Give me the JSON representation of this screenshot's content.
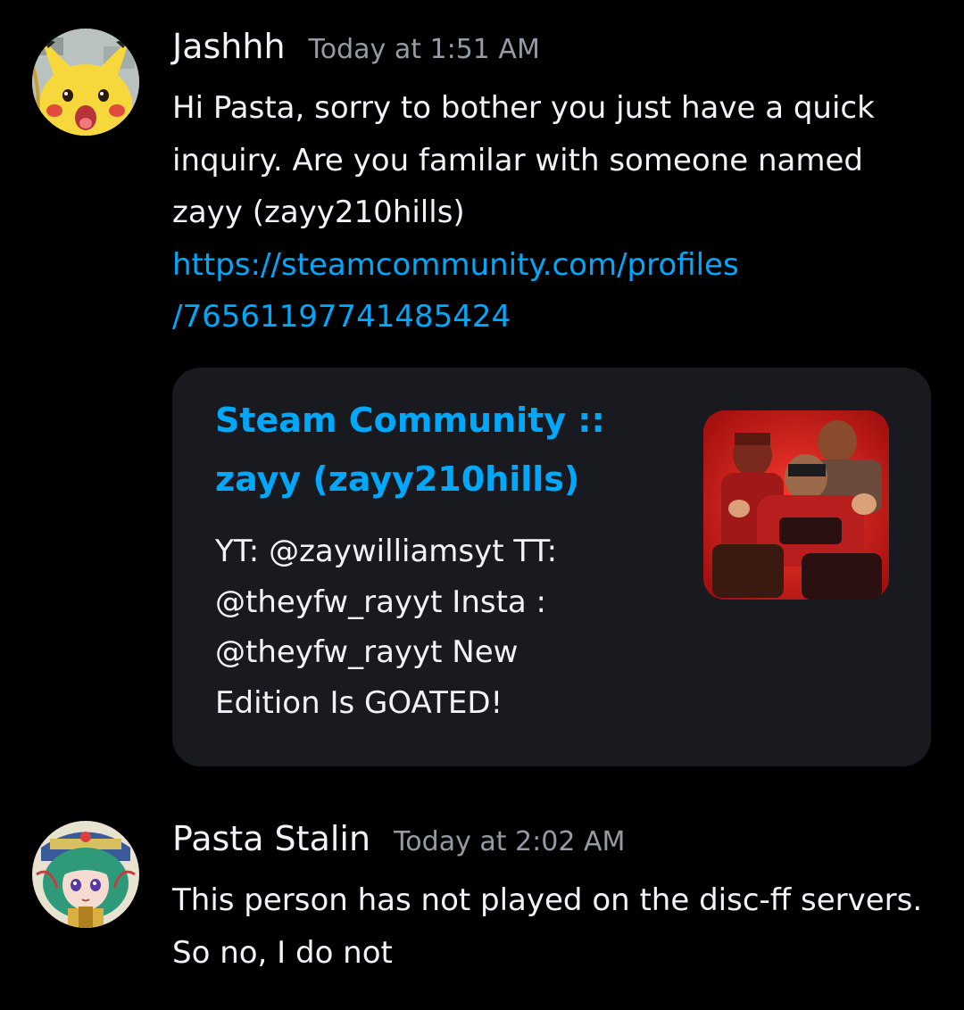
{
  "messages": [
    {
      "username": "Jashhh",
      "timestamp": "Today at 1:51 AM",
      "text": "Hi Pasta, sorry to bother you just have a quick inquiry. Are you familar with someone named zayy (zayy210hills)",
      "link_line1": "https://steamcommunity.com/profiles",
      "link_line2": "/76561197741485424",
      "avatar_icon": "pikachu-avatar-icon",
      "embed": {
        "title": "Steam Community :: zayy (zayy210hills)",
        "description": "YT: @zaywilliamsyt TT: @theyfw_rayyt Insta : @theyfw_rayyt New Edition Is GOATED!",
        "thumbnail_icon": "red-team-soldiers-thumbnail"
      }
    },
    {
      "username": "Pasta Stalin",
      "timestamp": "Today at 2:02 AM",
      "text": "This person has not played on the disc-ff servers. So no, I do not",
      "avatar_icon": "anime-girl-avatar-icon"
    }
  ],
  "colors": {
    "background": "#000000",
    "text": "#f2f3f5",
    "muted": "#949ba4",
    "link": "#00a8fc",
    "embed_bg": "#191a1f"
  }
}
